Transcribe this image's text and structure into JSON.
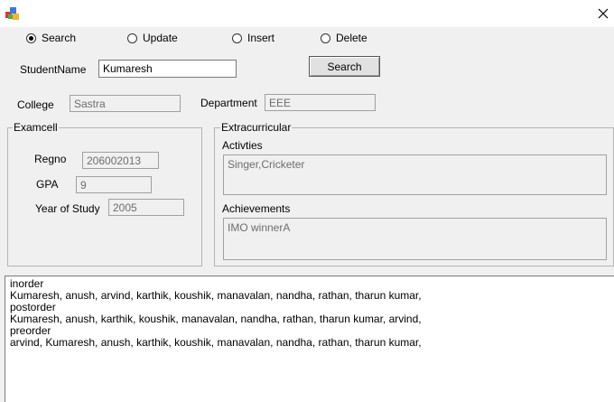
{
  "window": {
    "icon": "app-icon",
    "close_icon": "close-icon"
  },
  "mode_options": [
    {
      "label": "Search",
      "checked": true
    },
    {
      "label": "Update",
      "checked": false
    },
    {
      "label": "Insert",
      "checked": false
    },
    {
      "label": "Delete",
      "checked": false
    }
  ],
  "student_name": {
    "label": "StudentName",
    "value": "Kumaresh"
  },
  "search_button": {
    "label": "Search"
  },
  "college": {
    "label": "College",
    "value": "Sastra"
  },
  "department": {
    "label": "Department",
    "value": "EEE"
  },
  "examcell": {
    "title": "Examcell",
    "regno": {
      "label": "Regno",
      "value": "206002013"
    },
    "gpa": {
      "label": "GPA",
      "value": "9"
    },
    "year_of_study": {
      "label": "Year of Study",
      "value": "2005"
    }
  },
  "extracurricular": {
    "title": "Extracurricular",
    "activities": {
      "label": "Activties",
      "value": "Singer,Cricketer"
    },
    "achievements": {
      "label": "Achievements",
      "value": "IMO winnerA"
    }
  },
  "output_lines": [
    "inorder",
    "Kumaresh, anush, arvind, karthik, koushik, manavalan, nandha, rathan, tharun kumar,",
    "postorder",
    "Kumaresh, anush, karthik, koushik, manavalan, nandha, rathan, tharun kumar, arvind,",
    "preorder",
    "arvind, Kumaresh, anush, karthik, koushik, manavalan, nandha, rathan, tharun kumar,"
  ]
}
